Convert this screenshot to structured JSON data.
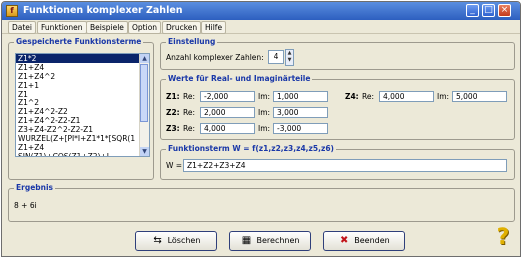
{
  "window": {
    "title": "Funktionen komplexer Zahlen",
    "app_icon_glyph": "f"
  },
  "menu": [
    "Datei",
    "Funktionen",
    "Beispiele",
    "Option",
    "Drucken",
    "Hilfe"
  ],
  "stored_terms": {
    "legend": "Gespeicherte Funktionsterme",
    "items": [
      "Z1*2",
      "Z1+Z4",
      "Z1+Z4^2",
      "Z1+1",
      "Z1",
      "Z1^2",
      "Z1+Z4^2-Z2",
      "Z1+Z4^2-Z2-Z1",
      "Z3+Z4-Z2^2-Z2-Z1",
      "WURZEL(Z+[PI*I+Z1*1*[SQR(1",
      "Z1+Z4",
      "SIN(Z1)+COS(Z1+Z2)+I",
      "COS(Z1+I)*3+3^2*2+I^2"
    ],
    "selected_index": 0
  },
  "settings": {
    "legend": "Einstellung",
    "count_label": "Anzahl komplexer Zahlen:",
    "count_value": "4"
  },
  "values": {
    "legend": "Werte für Real- und Imaginärteile",
    "rows": [
      {
        "name": "Z1:",
        "re_label": "Re:",
        "re": "-2,000",
        "im_label": "Im:",
        "im": "1,000"
      },
      {
        "name": "Z2:",
        "re_label": "Re:",
        "re": "2,000",
        "im_label": "Im:",
        "im": "3,000"
      },
      {
        "name": "Z3:",
        "re_label": "Re:",
        "re": "4,000",
        "im_label": "Im:",
        "im": "-3,000"
      },
      {
        "name": "Z4:",
        "re_label": "Re:",
        "re": "4,000",
        "im_label": "Im:",
        "im": "5,000"
      }
    ]
  },
  "function_term": {
    "legend": "Funktionsterm W = f(z1,z2,z3,z4,z5,z6)",
    "w_label": "W =",
    "value": "Z1+Z2+Z3+Z4"
  },
  "result": {
    "legend": "Ergebnis",
    "value": "8 + 6i"
  },
  "buttons": {
    "clear": "Löschen",
    "calculate": "Berechnen",
    "quit": "Beenden"
  },
  "help_glyph": "?",
  "colors": {
    "title_bar": "#2d5fbf",
    "legend_text": "#1a38a8",
    "selection": "#0a246a",
    "window_bg": "#ece9d8"
  }
}
